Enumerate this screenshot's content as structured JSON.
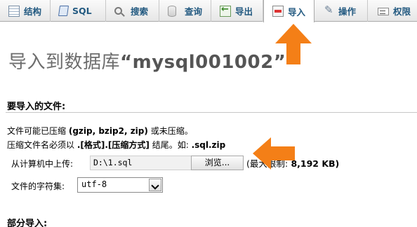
{
  "tabs": [
    {
      "label": "结构",
      "icon": "structure-icon"
    },
    {
      "label": "SQL",
      "icon": "sql-icon"
    },
    {
      "label": "搜索",
      "icon": "search-icon"
    },
    {
      "label": "查询",
      "icon": "query-icon"
    },
    {
      "label": "导出",
      "icon": "export-icon"
    },
    {
      "label": "导入",
      "icon": "import-icon",
      "active": true
    },
    {
      "label": "操作",
      "icon": "operations-icon"
    },
    {
      "label": "权限",
      "icon": "privileges-icon"
    }
  ],
  "page": {
    "title_prefix": "导入到数据库",
    "title_db": "“mysql001002”"
  },
  "import_file": {
    "heading": "要导入的文件:",
    "compress_line": {
      "text1": "文件可能已压缩 ",
      "formats": "(gzip, bzip2, zip)",
      "text2": " 或未压缩。"
    },
    "naming_line": {
      "text1": "压缩文件名必须以 ",
      "pattern": ".[格式].[压缩方式]",
      "text2": " 结尾。如: ",
      "example": ".sql.zip"
    },
    "upload_label": "从计算机中上传:",
    "file_value": "D:\\1.sql",
    "browse_label": "浏览...",
    "max_size_prefix": "(最大限制:",
    "max_size_value": " 8,192 KB)",
    "charset_label": "文件的字符集:",
    "charset_value": "utf-8"
  },
  "partial_import": {
    "heading": "部分导入:"
  },
  "colors": {
    "annotation_arrow": "#f47f17",
    "tab_text": "#235a81"
  }
}
